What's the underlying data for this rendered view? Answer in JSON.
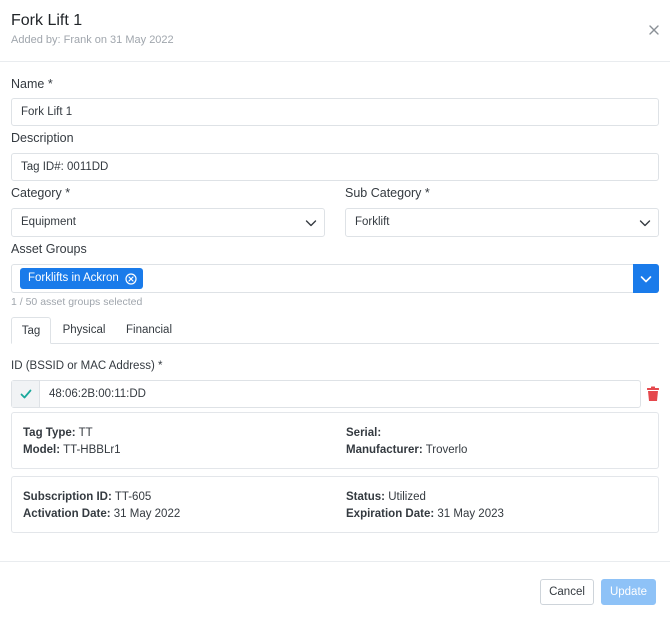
{
  "header": {
    "title": "Fork Lift 1",
    "subtitle": "Added by: Frank on 31 May 2022"
  },
  "form": {
    "name_label": "Name *",
    "name_value": "Fork Lift 1",
    "description_label": "Description",
    "description_value": "Tag ID#: 0011DD",
    "category_label": "Category *",
    "category_value": "Equipment",
    "subcategory_label": "Sub Category *",
    "subcategory_value": "Forklift",
    "asset_groups_label": "Asset Groups",
    "asset_groups": [
      "Forklifts in Ackron"
    ],
    "asset_groups_count": "1 / 50 asset groups selected"
  },
  "tabs": [
    {
      "label": "Tag",
      "active": true
    },
    {
      "label": "Physical",
      "active": false
    },
    {
      "label": "Financial",
      "active": false
    }
  ],
  "tag": {
    "id_label": "ID (BSSID or MAC Address) *",
    "id_value": "48:06:2B:00:11:DD",
    "tag_type_key": "Tag Type:",
    "tag_type_value": "TT",
    "serial_key": "Serial:",
    "serial_value": "",
    "model_key": "Model:",
    "model_value": "TT-HBBLr1",
    "manufacturer_key": "Manufacturer:",
    "manufacturer_value": "Troverlo",
    "subscription_id_key": "Subscription ID:",
    "subscription_id_value": "TT-605",
    "status_key": "Status:",
    "status_value": "Utilized",
    "activation_key": "Activation Date:",
    "activation_value": "31 May 2022",
    "expiration_key": "Expiration Date:",
    "expiration_value": "31 May 2023"
  },
  "footer": {
    "cancel_label": "Cancel",
    "update_label": "Update"
  },
  "icons": {
    "close": "close-icon",
    "chevron": "chevron-down-icon",
    "chip_remove": "remove-circle-icon",
    "check": "check-icon",
    "trash": "trash-icon"
  },
  "colors": {
    "primary": "#1a7bea",
    "primary_disabled": "#8ec2f7",
    "check": "#1aa99c",
    "danger": "#e5484d",
    "muted_text": "#a0a6ad"
  }
}
